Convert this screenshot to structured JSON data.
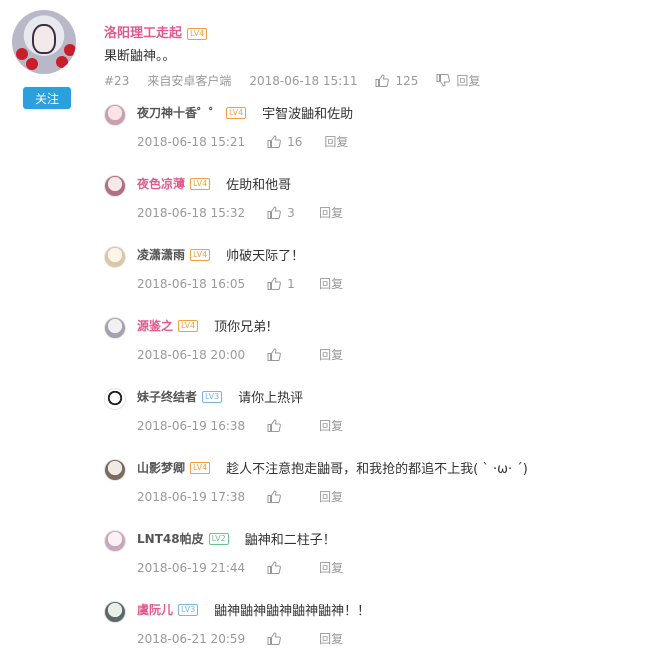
{
  "main_comment": {
    "username": "洛阳理工走起",
    "level": "LV4",
    "text": "果断鼬神。。",
    "floor": "#23",
    "source": "来自安卓客户端",
    "time": "2018-06-18 15:11",
    "likes": "125",
    "reply_label": "回复",
    "follow_label": "关注"
  },
  "replies": [
    {
      "username": "夜刀神十香゜゜",
      "level": "LV4",
      "text": "宇智波鼬和佐助",
      "time": "2018-06-18 15:21",
      "likes": "16",
      "reply_label": "回复"
    },
    {
      "username": "夜色凉薄",
      "level": "LV4",
      "text": "佐助和他哥",
      "time": "2018-06-18 15:32",
      "likes": "3",
      "reply_label": "回复"
    },
    {
      "username": "凌潇潇雨",
      "level": "LV4",
      "text": "帅破天际了！",
      "time": "2018-06-18 16:05",
      "likes": "1",
      "reply_label": "回复"
    },
    {
      "username": "源鉴之",
      "level": "LV4",
      "text": "顶你兄弟!",
      "time": "2018-06-18 20:00",
      "likes": "",
      "reply_label": "回复"
    },
    {
      "username": "妹子终结者",
      "level": "LV3",
      "text": "请你上热评",
      "time": "2018-06-19 16:38",
      "likes": "",
      "reply_label": "回复"
    },
    {
      "username": "山影梦卿",
      "level": "LV4",
      "text": "趁人不注意抱走鼬哥，和我抢的都追不上我( ˋ ·ω· ˊ)",
      "time": "2018-06-19 17:38",
      "likes": "",
      "reply_label": "回复"
    },
    {
      "username": "LNT48帕皮",
      "level": "LV2",
      "text": "鼬神和二柱子！",
      "time": "2018-06-19 21:44",
      "likes": "",
      "reply_label": "回复"
    },
    {
      "username": "虞阮儿",
      "level": "LV3",
      "text": "鼬神鼬神鼬神鼬神鼬神！！",
      "time": "2018-06-21 20:59",
      "likes": "",
      "reply_label": "回复"
    }
  ],
  "colors": {
    "accent": "#2aa0dd",
    "vip_name": "#e25a8c",
    "meta": "#999999",
    "level_orange": "#f2a03c",
    "level_blue": "#7ab5e0",
    "level_green": "#6bc18c"
  },
  "icons": {
    "like": "thumbs-up-icon",
    "dislike": "thumbs-down-icon"
  }
}
